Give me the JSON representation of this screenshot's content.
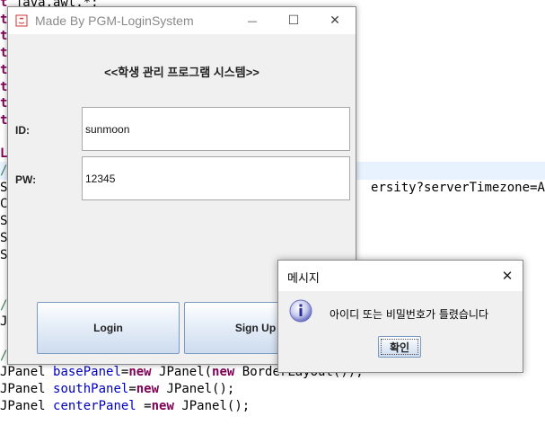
{
  "editor": {
    "lines": [
      {
        "parts": [
          {
            "t": "t ",
            "c": "kw"
          },
          {
            "t": "java.awt.*;",
            "c": ""
          }
        ]
      },
      {
        "parts": [
          {
            "t": "t",
            "c": "kw"
          }
        ]
      },
      {
        "parts": [
          {
            "t": "t",
            "c": "kw"
          }
        ]
      },
      {
        "parts": [
          {
            "t": "t",
            "c": "kw"
          }
        ]
      },
      {
        "parts": [
          {
            "t": "t",
            "c": "kw"
          }
        ]
      },
      {
        "parts": [
          {
            "t": "t",
            "c": "kw"
          }
        ]
      },
      {
        "parts": [
          {
            "t": "t",
            "c": "kw"
          }
        ]
      },
      {
        "parts": [
          {
            "t": "t",
            "c": "kw"
          }
        ]
      },
      {
        "parts": [
          {
            "t": "",
            "c": ""
          }
        ]
      },
      {
        "parts": [
          {
            "t": "L",
            "c": "kw"
          }
        ]
      },
      {
        "parts": [
          {
            "t": "/",
            "c": "cmt"
          }
        ]
      },
      {
        "parts": [
          {
            "t": "St",
            "c": ""
          },
          {
            "t": "                                               ersity?serverTimezone=As",
            "c": ""
          }
        ]
      },
      {
        "parts": [
          {
            "t": "Co",
            "c": ""
          }
        ]
      },
      {
        "parts": [
          {
            "t": "St",
            "c": ""
          }
        ]
      },
      {
        "parts": [
          {
            "t": "St",
            "c": ""
          }
        ]
      },
      {
        "parts": [
          {
            "t": "St",
            "c": ""
          }
        ]
      },
      {
        "parts": [
          {
            "t": "",
            "c": ""
          }
        ]
      },
      {
        "parts": [
          {
            "t": "",
            "c": ""
          }
        ]
      },
      {
        "parts": [
          {
            "t": "/",
            "c": "cmt"
          }
        ]
      },
      {
        "parts": [
          {
            "t": "JL",
            "c": ""
          }
        ]
      },
      {
        "parts": [
          {
            "t": "",
            "c": ""
          }
        ]
      },
      {
        "parts": [
          {
            "t": "//",
            "c": "cmt"
          }
        ]
      },
      {
        "parts": [
          {
            "t": "JPanel ",
            "c": ""
          },
          {
            "t": "basePanel",
            "c": "fld"
          },
          {
            "t": "=",
            "c": ""
          },
          {
            "t": "new",
            "c": "kw"
          },
          {
            "t": " JPanel(",
            "c": ""
          },
          {
            "t": "new",
            "c": "kw"
          },
          {
            "t": " BorderLayout());",
            "c": ""
          }
        ]
      },
      {
        "parts": [
          {
            "t": "JPanel ",
            "c": ""
          },
          {
            "t": "southPanel",
            "c": "fld"
          },
          {
            "t": "=",
            "c": ""
          },
          {
            "t": "new",
            "c": "kw"
          },
          {
            "t": " JPanel();",
            "c": ""
          }
        ]
      },
      {
        "parts": [
          {
            "t": "JPanel ",
            "c": ""
          },
          {
            "t": "centerPanel",
            "c": "fld"
          },
          {
            "t": " =",
            "c": ""
          },
          {
            "t": "new",
            "c": "kw"
          },
          {
            "t": " JPanel();",
            "c": ""
          }
        ]
      }
    ]
  },
  "window": {
    "title": "Made By PGM-LoginSystem",
    "minimize_glyph": "—",
    "maximize_glyph": "☐",
    "close_glyph": "✕",
    "heading": "<<학생 관리 프로그램 시스템>>",
    "id_label": "ID:",
    "id_value": "sunmoon",
    "pw_label": "PW:",
    "pw_value": "12345",
    "login_label": "Login",
    "signup_label": "Sign Up"
  },
  "dialog": {
    "title": "메시지",
    "close_glyph": "✕",
    "message": "아이디 또는 비밀번호가 틀렸습니다",
    "ok_label": "확인",
    "icon": "info-icon",
    "icon_color": "#6a6fbf"
  },
  "colors": {
    "keyword": "#7f0055",
    "field": "#0000c0",
    "comment": "#3f7f5f",
    "button_border": "#7a9ac2"
  }
}
